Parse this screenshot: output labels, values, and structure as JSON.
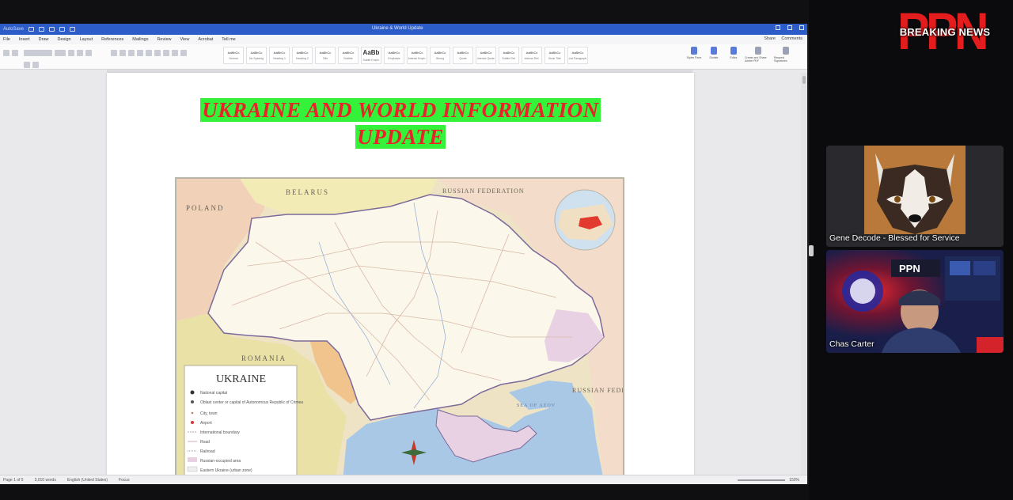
{
  "word": {
    "autosave": "AutoSave",
    "doc_title": "Ukraine & World Update",
    "menu": [
      "File",
      "Insert",
      "Draw",
      "Design",
      "Layout",
      "References",
      "Mailings",
      "Review",
      "View",
      "Acrobat",
      "Tell me"
    ],
    "share": "Share",
    "comments": "Comments",
    "styles": [
      "Normal",
      "No Spacing",
      "Heading 1",
      "Heading 2",
      "Title",
      "Subtitle",
      "Subtle Emph.",
      "Emphasis",
      "Intense Emph.",
      "Strong",
      "Quote",
      "Intense Quote",
      "Subtle Ref.",
      "Intense Ref.",
      "Book Title",
      "List Paragraph"
    ],
    "big_style": "AaBb",
    "tools": [
      "Styles Pane",
      "Dictate",
      "Editor",
      "Create and Share Adobe PDF",
      "Request Signatures"
    ],
    "status": [
      "Page 1 of 5",
      "3,010 words",
      "English (United States)",
      "Focus"
    ],
    "zoom": "150%"
  },
  "document": {
    "title_line1": "UKRAINE AND WORLD INFORMATION",
    "title_line2": "UPDATE",
    "map": {
      "country_labels": [
        "BELARUS",
        "POLAND",
        "RUSSIAN FEDERATION",
        "RUSSIAN FEDERATION",
        "ROMANIA",
        "SEA OF AZOV"
      ],
      "legend_title": "UKRAINE",
      "legend_items": [
        "National capital",
        "Oblast center or capital of Autonomous Republic of Crimea",
        "City, town",
        "Airport",
        "International boundary",
        "Road",
        "Railroad",
        "Russian-occupied area",
        "Eastern Ukraine (urban zone)"
      ]
    }
  },
  "call": {
    "logo_letters": "PPN",
    "logo_banner": "BREAKING NEWS",
    "participants": [
      {
        "name": "Gene Decode - Blessed for Service"
      },
      {
        "name": "Chas Carter"
      }
    ]
  },
  "colors": {
    "heading_text": "#e8232a",
    "heading_highlight": "#34f23a",
    "logo_red": "#e31d1d",
    "word_titlebar": "#2b5cc8"
  }
}
